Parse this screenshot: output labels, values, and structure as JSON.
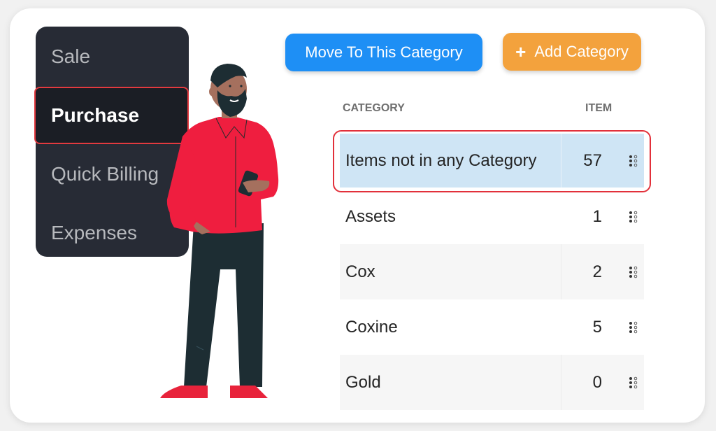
{
  "sidebar": {
    "items": [
      {
        "label": "Sale",
        "active": false
      },
      {
        "label": "Purchase",
        "active": true
      },
      {
        "label": "Quick Billing",
        "active": false
      },
      {
        "label": "Expenses",
        "active": false
      }
    ]
  },
  "toolbar": {
    "move_label": "Move To This Category",
    "add_icon": "+",
    "add_label": "Add Category"
  },
  "table": {
    "headers": {
      "category": "CATEGORY",
      "item": "ITEM"
    },
    "rows": [
      {
        "name": "Items not in any Category",
        "count": "57",
        "selected": true
      },
      {
        "name": "Assets",
        "count": "1"
      },
      {
        "name": "Cox",
        "count": "2"
      },
      {
        "name": "Coxine",
        "count": "5"
      },
      {
        "name": "Gold",
        "count": "0"
      }
    ]
  },
  "colors": {
    "primary_button": "#1e8ff5",
    "secondary_button": "#f3a23d",
    "sidebar_bg": "#272b35",
    "highlight_border": "#e2303a",
    "selected_row": "#cfe5f5"
  },
  "illustration": "man-with-phone-illustration"
}
